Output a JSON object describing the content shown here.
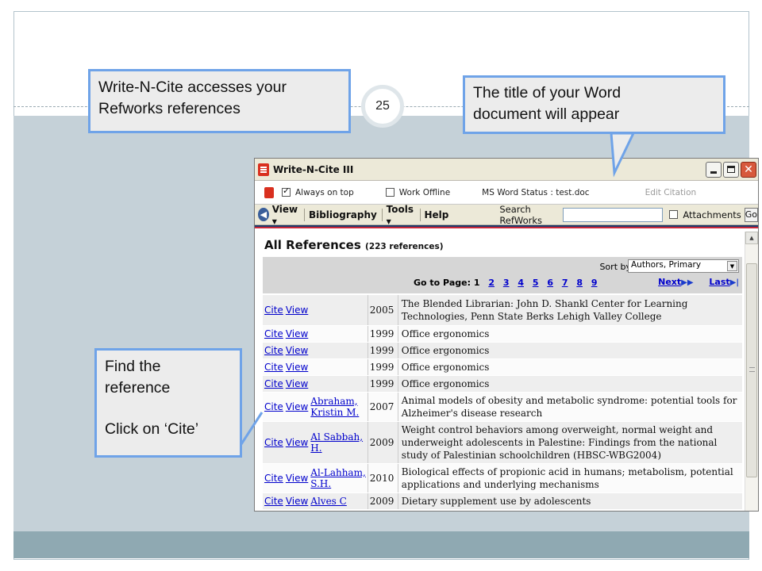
{
  "slide": {
    "page_number": "25",
    "callouts": {
      "wnc_access": [
        "Write-N-Cite accesses your",
        "Refworks references"
      ],
      "word_title": [
        "The title of your Word",
        "document will appear"
      ],
      "find_ref": [
        "Find the",
        "reference",
        "Click on ‘Cite’"
      ]
    }
  },
  "window": {
    "title": "Write-N-Cite III",
    "options": {
      "always_on_top": "Always on top",
      "work_offline": "Work Offline",
      "word_status": "MS Word Status : test.doc",
      "edit_citation": "Edit Citation"
    },
    "toolbar": {
      "view": "View",
      "bibliography": "Bibliography",
      "tools": "Tools",
      "help": "Help",
      "search_label": "Search RefWorks",
      "attachments": "Attachments",
      "go": "Go"
    },
    "heading": "All References",
    "heading_count": "(223 references)",
    "sort": {
      "label": "Sort by",
      "selected": "Authors, Primary"
    },
    "pager": {
      "label": "Go to Page:",
      "current": "1",
      "pages": [
        "2",
        "3",
        "4",
        "5",
        "6",
        "7",
        "8",
        "9"
      ],
      "next": "Next",
      "last": "Last"
    },
    "actions": {
      "cite": "Cite",
      "view": "View"
    },
    "references": [
      {
        "author": "",
        "year": "2005",
        "title": "The Blended Librarian: John D. Shankl Center for Learning Technologies, Penn State Berks Lehigh Valley College"
      },
      {
        "author": "",
        "year": "1999",
        "title": "Office ergonomics"
      },
      {
        "author": "",
        "year": "1999",
        "title": "Office ergonomics"
      },
      {
        "author": "",
        "year": "1999",
        "title": "Office ergonomics"
      },
      {
        "author": "",
        "year": "1999",
        "title": "Office ergonomics"
      },
      {
        "author": "Abraham, Kristin M.",
        "year": "2007",
        "title": "Animal models of obesity and metabolic syndrome: potential tools for Alzheimer's disease research"
      },
      {
        "author": "Al Sabbah, H.",
        "year": "2009",
        "title": "Weight control behaviors among overweight, normal weight and underweight adolescents in Palestine: Findings from the national study of Palestinian schoolchildren (HBSC-WBG2004)"
      },
      {
        "author": "Al-Lahham, S.H.",
        "year": "2010",
        "title": "Biological effects of propionic acid in humans; metabolism, potential applications and underlying mechanisms"
      },
      {
        "author": "Alves C",
        "year": "2009",
        "title": "Dietary supplement use by adolescents"
      }
    ]
  }
}
